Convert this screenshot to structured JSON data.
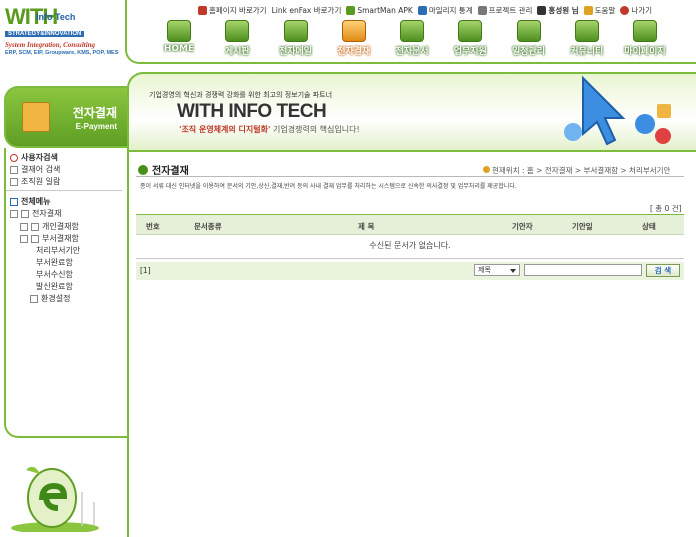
{
  "logo": {
    "with": "WITH",
    "info_tech": "Info Tech",
    "strategy": "STRATEGY&INNOVATION",
    "system": "System Integration, Consulting",
    "products": "ERP, SCM, EIP, Groupware, KMS, POP, MES"
  },
  "top_links": [
    {
      "label": "홈페이지 바로가기",
      "icon": "home-icon",
      "color": "#c0392b"
    },
    {
      "label": "Link enFax 바로가기",
      "icon": "fax-icon",
      "color": "#2c6db3"
    },
    {
      "label": "SmartMan APK",
      "icon": "mobile-icon",
      "color": "#5a9a1e"
    },
    {
      "label": "마일리지 통계",
      "icon": "chart-icon",
      "color": "#2c6db3"
    },
    {
      "label": "프로젝트 관리",
      "icon": "project-icon",
      "color": "#555555"
    },
    {
      "label": "홍성원 님",
      "icon": "user-icon",
      "color": "#333333"
    },
    {
      "label": "도움말",
      "icon": "help-icon",
      "color": "#e0a020"
    },
    {
      "label": "나가기",
      "icon": "logout-icon",
      "color": "#c0392b"
    }
  ],
  "menu": [
    {
      "label": "HOME",
      "icon": "home-icon"
    },
    {
      "label": "게시판",
      "icon": "board-icon"
    },
    {
      "label": "전자메일",
      "icon": "mail-icon"
    },
    {
      "label": "전자결재",
      "icon": "approval-icon",
      "active": true
    },
    {
      "label": "전자문서",
      "icon": "document-icon"
    },
    {
      "label": "업무지원",
      "icon": "support-icon"
    },
    {
      "label": "일정관리",
      "icon": "calendar-icon"
    },
    {
      "label": "커뮤니티",
      "icon": "community-icon"
    },
    {
      "label": "마이페이지",
      "icon": "mypage-icon"
    }
  ],
  "sidebar": {
    "title": "전자결재",
    "subtitle": "E-Payment",
    "search_title": "사용자검색",
    "search_items": [
      "결재어 검색",
      "조직원 일람"
    ],
    "menu_title": "전체메뉴",
    "tree": [
      {
        "label": "전자결재",
        "level": 0
      },
      {
        "label": "개인결재함",
        "level": 1
      },
      {
        "label": "부서결재함",
        "level": 1
      },
      {
        "label": "처리부서기안",
        "level": 2
      },
      {
        "label": "부서완료함",
        "level": 2
      },
      {
        "label": "부서수신함",
        "level": 2
      },
      {
        "label": "발신완료함",
        "level": 2
      },
      {
        "label": "환경설정",
        "level": 1
      }
    ]
  },
  "banner": {
    "sub": "기업경영의 혁신과 경쟁력 강화를 위한 최고의 정보기술 파트너",
    "big": "WITH INFO TECH",
    "slogan_bold": "'조직 운영체계의 디지털화'",
    "slogan_rest": " 기업경쟁력의 핵심입니다!"
  },
  "content": {
    "title": "전자결재",
    "breadcrumb": "현재위치 : 홈 > 전자결재 > 부서결재함 > 처리부서기안",
    "description": "종이 서류 대신 인터넷을 이용하여 문서의 기안,상신,결재,반려 등의 사내 결재 업무를 처리하는 시스템으로 신속한 의사결정 및 업무처리를 제공합니다.",
    "count": "[ 총 0 건]",
    "columns": [
      "번호",
      "문서종류",
      "제 목",
      "기안자",
      "기안일",
      "상태"
    ],
    "empty_message": "수신된 문서가 없습니다.",
    "page": "[1]",
    "search_select": "제목",
    "search_value": "",
    "search_button": "검 색"
  }
}
